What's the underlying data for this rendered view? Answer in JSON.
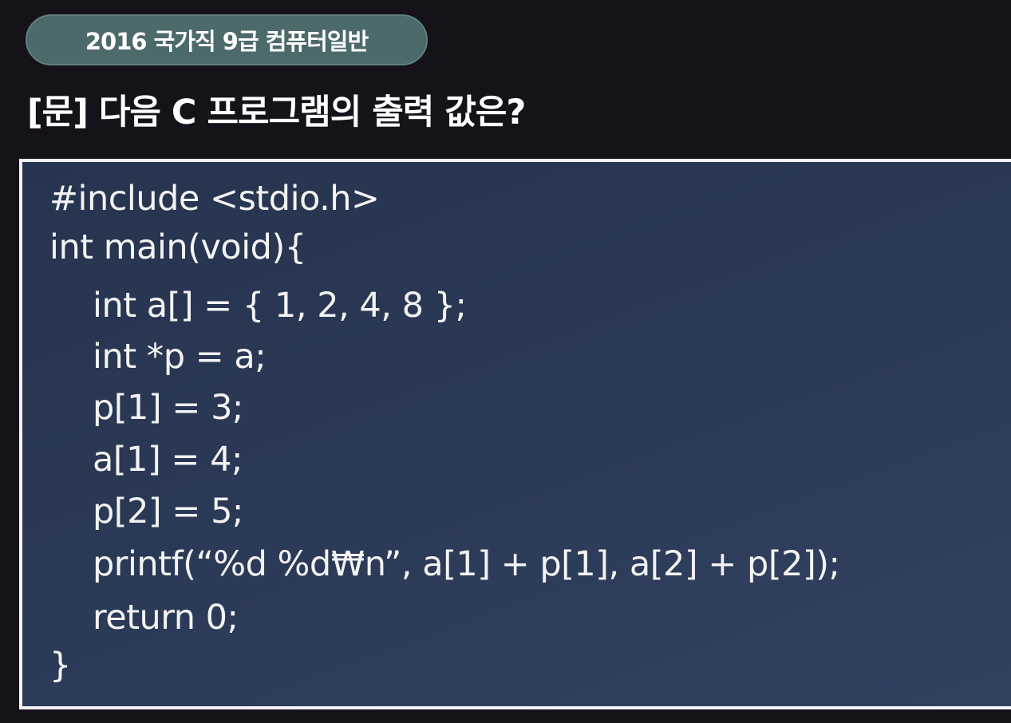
{
  "header": {
    "badge": "2016 국가직 9급 컴퓨터일반",
    "question": "[문] 다음 C 프로그램의 출력 값은?"
  },
  "code": {
    "lines": [
      "#include <stdio.h>",
      "int main(void){",
      "int a[] = { 1, 2, 4, 8 };",
      "int *p = a;",
      "p[1] = 3;",
      "a[1] = 4;",
      "p[2] = 5;",
      "printf(“%d %d₩n”, a[1] + p[1], a[2] + p[2]);",
      "return 0;",
      "}"
    ]
  }
}
